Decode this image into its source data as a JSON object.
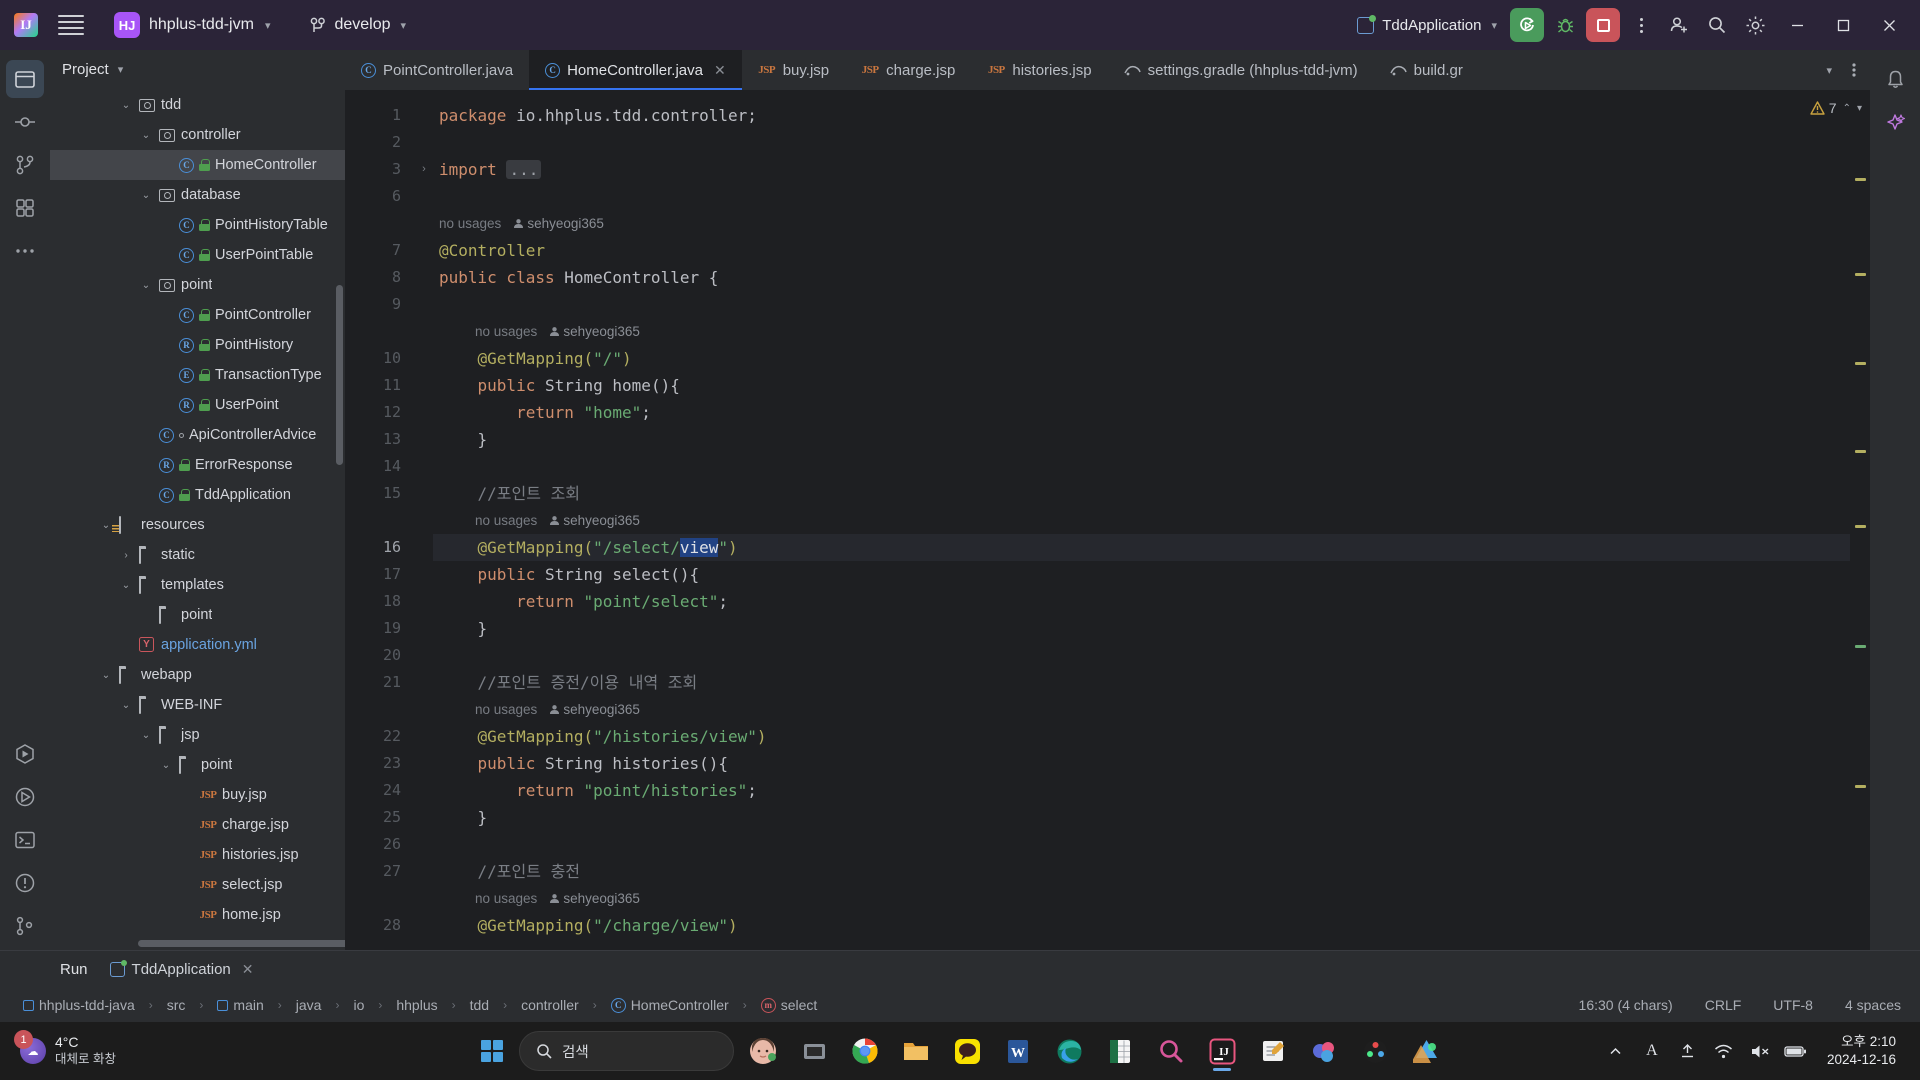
{
  "titlebar": {
    "project_badge": "HJ",
    "project_name": "hhplus-tdd-jvm",
    "branch": "develop",
    "run_config": "TddApplication"
  },
  "project_panel": {
    "title": "Project",
    "tree": [
      {
        "indent": 3,
        "arrow": "down",
        "icon": "package",
        "label": "tdd",
        "selected": false
      },
      {
        "indent": 4,
        "arrow": "down",
        "icon": "package",
        "label": "controller",
        "selected": false
      },
      {
        "indent": 5,
        "arrow": "none",
        "icon": "class-lock",
        "label": "HomeController",
        "selected": true
      },
      {
        "indent": 4,
        "arrow": "down",
        "icon": "package",
        "label": "database",
        "selected": false
      },
      {
        "indent": 5,
        "arrow": "none",
        "icon": "class-lock",
        "label": "PointHistoryTable",
        "selected": false
      },
      {
        "indent": 5,
        "arrow": "none",
        "icon": "class-lock",
        "label": "UserPointTable",
        "selected": false
      },
      {
        "indent": 4,
        "arrow": "down",
        "icon": "package",
        "label": "point",
        "selected": false
      },
      {
        "indent": 5,
        "arrow": "none",
        "icon": "class-lock",
        "label": "PointController",
        "selected": false
      },
      {
        "indent": 5,
        "arrow": "none",
        "icon": "record-lock",
        "label": "PointHistory",
        "selected": false
      },
      {
        "indent": 5,
        "arrow": "none",
        "icon": "enum-lock",
        "label": "TransactionType",
        "selected": false
      },
      {
        "indent": 5,
        "arrow": "none",
        "icon": "record-lock",
        "label": "UserPoint",
        "selected": false
      },
      {
        "indent": 4,
        "arrow": "none",
        "icon": "class-dot",
        "label": "ApiControllerAdvice",
        "selected": false
      },
      {
        "indent": 4,
        "arrow": "none",
        "icon": "record-lock",
        "label": "ErrorResponse",
        "selected": false
      },
      {
        "indent": 4,
        "arrow": "none",
        "icon": "class-lock",
        "label": "TddApplication",
        "selected": false
      },
      {
        "indent": 2,
        "arrow": "down",
        "icon": "resources",
        "label": "resources",
        "selected": false
      },
      {
        "indent": 3,
        "arrow": "right",
        "icon": "folder",
        "label": "static",
        "selected": false
      },
      {
        "indent": 3,
        "arrow": "down",
        "icon": "folder",
        "label": "templates",
        "selected": false
      },
      {
        "indent": 4,
        "arrow": "none",
        "icon": "folder",
        "label": "point",
        "selected": false
      },
      {
        "indent": 3,
        "arrow": "none",
        "icon": "yml",
        "label": "application.yml",
        "selected": false,
        "yml": true
      },
      {
        "indent": 2,
        "arrow": "down",
        "icon": "folder",
        "label": "webapp",
        "selected": false
      },
      {
        "indent": 3,
        "arrow": "down",
        "icon": "folder",
        "label": "WEB-INF",
        "selected": false
      },
      {
        "indent": 4,
        "arrow": "down",
        "icon": "folder",
        "label": "jsp",
        "selected": false
      },
      {
        "indent": 5,
        "arrow": "down",
        "icon": "folder",
        "label": "point",
        "selected": false
      },
      {
        "indent": 6,
        "arrow": "none",
        "icon": "jsp",
        "label": "buy.jsp",
        "selected": false
      },
      {
        "indent": 6,
        "arrow": "none",
        "icon": "jsp",
        "label": "charge.jsp",
        "selected": false
      },
      {
        "indent": 6,
        "arrow": "none",
        "icon": "jsp",
        "label": "histories.jsp",
        "selected": false
      },
      {
        "indent": 6,
        "arrow": "none",
        "icon": "jsp",
        "label": "select.jsp",
        "selected": false
      },
      {
        "indent": 6,
        "arrow": "none",
        "icon": "jsp",
        "label": "home.jsp",
        "selected": false
      }
    ]
  },
  "editor": {
    "tabs": [
      {
        "label": "PointController.java",
        "icon": "java-class",
        "active": false,
        "closable": false
      },
      {
        "label": "HomeController.java",
        "icon": "java-class",
        "active": true,
        "closable": true
      },
      {
        "label": "buy.jsp",
        "icon": "jsp",
        "active": false,
        "closable": false
      },
      {
        "label": "charge.jsp",
        "icon": "jsp",
        "active": false,
        "closable": false
      },
      {
        "label": "histories.jsp",
        "icon": "jsp",
        "active": false,
        "closable": false
      },
      {
        "label": "settings.gradle (hhplus-tdd-jvm)",
        "icon": "gradle",
        "active": false,
        "closable": false
      },
      {
        "label": "build.gr",
        "icon": "gradle",
        "active": false,
        "closable": false
      }
    ],
    "warning_count": "7",
    "lines": [
      {
        "num": "1",
        "type": "code",
        "tokens": [
          {
            "t": "package ",
            "c": "k"
          },
          {
            "t": "io.hhplus.tdd.controller;",
            "c": "t"
          }
        ]
      },
      {
        "num": "2",
        "type": "code",
        "tokens": []
      },
      {
        "num": "3",
        "type": "code",
        "fold": true,
        "tokens": [
          {
            "t": "import ",
            "c": "k"
          },
          {
            "t": "...",
            "c": "dots"
          }
        ]
      },
      {
        "num": "6",
        "type": "code",
        "tokens": []
      },
      {
        "num": "",
        "type": "hint",
        "text": "no usages",
        "author": "sehyeogi365",
        "ind": 0
      },
      {
        "num": "7",
        "type": "code",
        "tokens": [
          {
            "t": "@Controller",
            "c": "a"
          }
        ]
      },
      {
        "num": "8",
        "type": "code",
        "tokens": [
          {
            "t": "public class ",
            "c": "k"
          },
          {
            "t": "HomeController ",
            "c": "t"
          },
          {
            "t": "{",
            "c": "p"
          }
        ]
      },
      {
        "num": "9",
        "type": "code",
        "tokens": []
      },
      {
        "num": "",
        "type": "hint",
        "text": "no usages",
        "author": "sehyeogi365",
        "ind": 1
      },
      {
        "num": "10",
        "type": "code",
        "tokens": [
          {
            "t": "    @GetMapping(",
            "c": "a"
          },
          {
            "t": "\"/\"",
            "c": "s"
          },
          {
            "t": ")",
            "c": "a"
          }
        ]
      },
      {
        "num": "11",
        "type": "code",
        "tokens": [
          {
            "t": "    public ",
            "c": "k"
          },
          {
            "t": "String ",
            "c": "t"
          },
          {
            "t": "home",
            "c": "m"
          },
          {
            "t": "(){",
            "c": "p"
          }
        ]
      },
      {
        "num": "12",
        "type": "code",
        "tokens": [
          {
            "t": "        return ",
            "c": "k"
          },
          {
            "t": "\"home\"",
            "c": "s"
          },
          {
            "t": ";",
            "c": "p"
          }
        ]
      },
      {
        "num": "13",
        "type": "code",
        "tokens": [
          {
            "t": "    }",
            "c": "p"
          }
        ]
      },
      {
        "num": "14",
        "type": "code",
        "tokens": []
      },
      {
        "num": "15",
        "type": "code",
        "tokens": [
          {
            "t": "    //포인트 조회",
            "c": "c"
          }
        ]
      },
      {
        "num": "",
        "type": "hint",
        "text": "no usages",
        "author": "sehyeogi365",
        "ind": 1
      },
      {
        "num": "16",
        "type": "code",
        "highlight": true,
        "tokens": [
          {
            "t": "    @GetMapping(",
            "c": "a"
          },
          {
            "t": "\"/select/",
            "c": "s"
          },
          {
            "t": "view",
            "c": "sel"
          },
          {
            "t": "\"",
            "c": "s"
          },
          {
            "t": ")",
            "c": "a"
          }
        ]
      },
      {
        "num": "17",
        "type": "code",
        "tokens": [
          {
            "t": "    public ",
            "c": "k"
          },
          {
            "t": "String ",
            "c": "t"
          },
          {
            "t": "select",
            "c": "m"
          },
          {
            "t": "(){",
            "c": "p"
          }
        ]
      },
      {
        "num": "18",
        "type": "code",
        "tokens": [
          {
            "t": "        return ",
            "c": "k"
          },
          {
            "t": "\"point/select\"",
            "c": "s"
          },
          {
            "t": ";",
            "c": "p"
          }
        ]
      },
      {
        "num": "19",
        "type": "code",
        "tokens": [
          {
            "t": "    }",
            "c": "p"
          }
        ]
      },
      {
        "num": "20",
        "type": "code",
        "tokens": []
      },
      {
        "num": "21",
        "type": "code",
        "tokens": [
          {
            "t": "    //포인트 증전/이용 내역 조회",
            "c": "c"
          }
        ]
      },
      {
        "num": "",
        "type": "hint",
        "text": "no usages",
        "author": "sehyeogi365",
        "ind": 1
      },
      {
        "num": "22",
        "type": "code",
        "tokens": [
          {
            "t": "    @GetMapping(",
            "c": "a"
          },
          {
            "t": "\"/histories/view\"",
            "c": "s"
          },
          {
            "t": ")",
            "c": "a"
          }
        ]
      },
      {
        "num": "23",
        "type": "code",
        "tokens": [
          {
            "t": "    public ",
            "c": "k"
          },
          {
            "t": "String ",
            "c": "t"
          },
          {
            "t": "histories",
            "c": "m"
          },
          {
            "t": "(){",
            "c": "p"
          }
        ]
      },
      {
        "num": "24",
        "type": "code",
        "tokens": [
          {
            "t": "        return ",
            "c": "k"
          },
          {
            "t": "\"point/histories\"",
            "c": "s"
          },
          {
            "t": ";",
            "c": "p"
          }
        ]
      },
      {
        "num": "25",
        "type": "code",
        "tokens": [
          {
            "t": "    }",
            "c": "p"
          }
        ]
      },
      {
        "num": "26",
        "type": "code",
        "tokens": []
      },
      {
        "num": "27",
        "type": "code",
        "tokens": [
          {
            "t": "    //포인트 충전",
            "c": "c"
          }
        ]
      },
      {
        "num": "",
        "type": "hint",
        "text": "no usages",
        "author": "sehyeogi365",
        "ind": 1
      },
      {
        "num": "28",
        "type": "code",
        "tokens": [
          {
            "t": "    @GetMapping(",
            "c": "a"
          },
          {
            "t": "\"/charge/view\"",
            "c": "s"
          },
          {
            "t": ")",
            "c": "a"
          }
        ]
      }
    ]
  },
  "run_panel": {
    "title": "Run",
    "tab_label": "TddApplication"
  },
  "status_bar": {
    "breadcrumb": [
      {
        "label": "hhplus-tdd-java",
        "icon": "module"
      },
      {
        "label": "src",
        "icon": "none"
      },
      {
        "label": "main",
        "icon": "module"
      },
      {
        "label": "java",
        "icon": "none"
      },
      {
        "label": "io",
        "icon": "none"
      },
      {
        "label": "hhplus",
        "icon": "none"
      },
      {
        "label": "tdd",
        "icon": "none"
      },
      {
        "label": "controller",
        "icon": "none"
      },
      {
        "label": "HomeController",
        "icon": "class"
      },
      {
        "label": "select",
        "icon": "method"
      }
    ],
    "caret": "16:30 (4 chars)",
    "line_sep": "CRLF",
    "encoding": "UTF-8",
    "indent": "4 spaces"
  },
  "taskbar": {
    "weather_temp": "4°C",
    "weather_desc": "대체로 화창",
    "search_placeholder": "검색",
    "clock_time": "오후 2:10",
    "clock_date": "2024-12-16",
    "notification_count": "1"
  },
  "colors": {
    "accent_blue": "#3573f0",
    "run_green": "#4a9b5c",
    "stop_red": "#c9545a",
    "title_bg": "#2b2438",
    "panel_bg": "#2b2d30",
    "editor_bg": "#1e1f22"
  }
}
